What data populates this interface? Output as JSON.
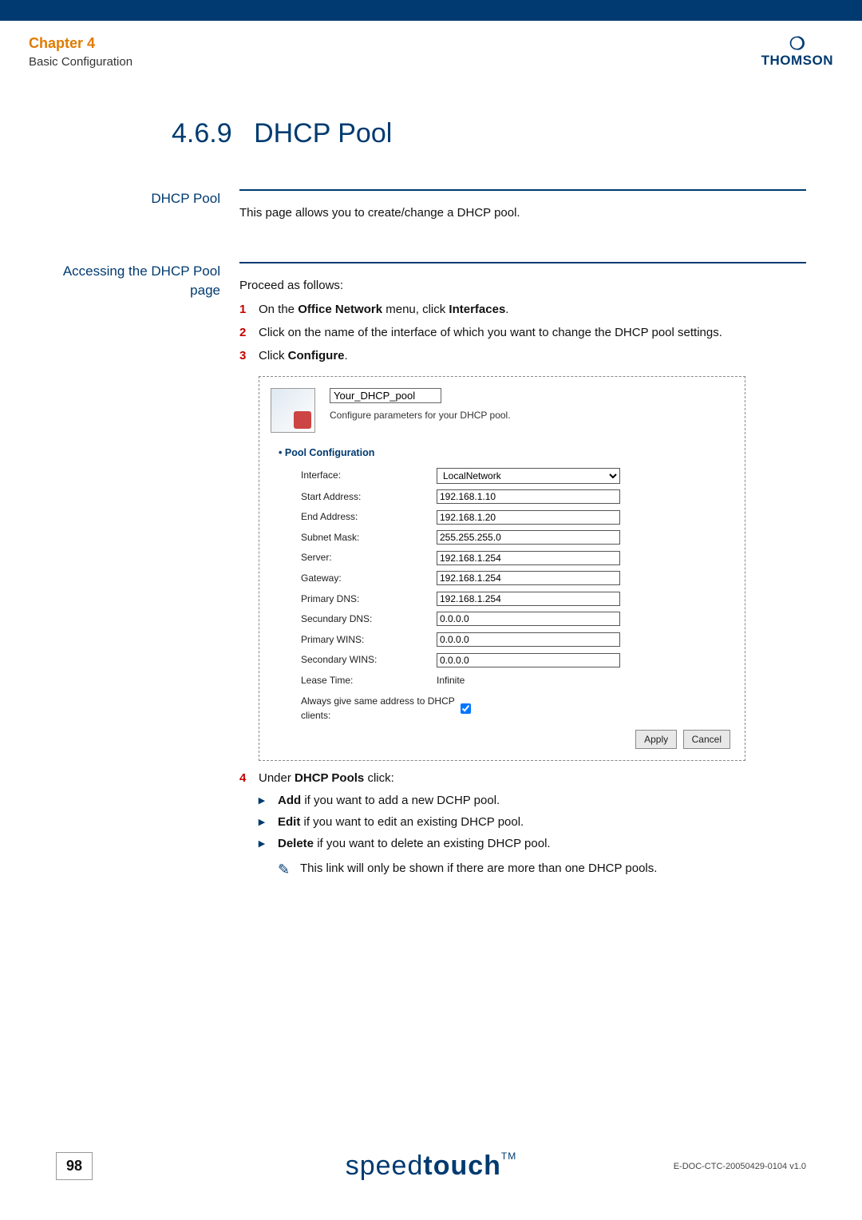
{
  "header": {
    "chapter": "Chapter 4",
    "subtitle": "Basic Configuration",
    "brand": "THOMSON"
  },
  "section": {
    "number": "4.6.9",
    "title": "DHCP Pool"
  },
  "block1": {
    "sidehead": "DHCP Pool",
    "text": "This page allows you to create/change a DHCP pool."
  },
  "block2": {
    "sidehead": "Accessing the DHCP Pool page",
    "intro": "Proceed as follows:",
    "steps": {
      "s1_pre": "On the ",
      "s1_b1": "Office Network",
      "s1_mid": " menu, click ",
      "s1_b2": "Interfaces",
      "s1_post": ".",
      "s2": "Click on the name of the interface of which you want to change the DHCP pool settings.",
      "s3_pre": "Click ",
      "s3_b": "Configure",
      "s3_post": ".",
      "s4_pre": "Under ",
      "s4_b": "DHCP Pools",
      "s4_post": " click:"
    },
    "sub": {
      "add_b": "Add",
      "add_t": " if you want to add a new DCHP pool.",
      "edit_b": "Edit",
      "edit_t": " if you want to edit an existing DHCP pool.",
      "del_b": "Delete",
      "del_t": " if you want to delete an existing DHCP pool.",
      "note": "This link will only be shown if there are more than one DHCP pools."
    }
  },
  "screenshot": {
    "poolname": "Your_DHCP_pool",
    "desc": "Configure parameters for your DHCP pool.",
    "config_title": "Pool Configuration",
    "labels": {
      "interface": "Interface:",
      "start": "Start Address:",
      "end": "End Address:",
      "subnet": "Subnet Mask:",
      "server": "Server:",
      "gateway": "Gateway:",
      "pdns": "Primary DNS:",
      "sdns": "Secundary DNS:",
      "pwins": "Primary WINS:",
      "swins": "Secondary WINS:",
      "lease": "Lease Time:",
      "always": "Always give same address to DHCP clients:"
    },
    "values": {
      "interface": "LocalNetwork",
      "start": "192.168.1.10",
      "end": "192.168.1.20",
      "subnet": "255.255.255.0",
      "server": "192.168.1.254",
      "gateway": "192.168.1.254",
      "pdns": "192.168.1.254",
      "sdns": "0.0.0.0",
      "pwins": "0.0.0.0",
      "swins": "0.0.0.0",
      "lease": "Infinite"
    },
    "buttons": {
      "apply": "Apply",
      "cancel": "Cancel"
    }
  },
  "footer": {
    "page": "98",
    "brand_light": "speed",
    "brand_bold": "touch",
    "tm": "TM",
    "docid": "E-DOC-CTC-20050429-0104 v1.0"
  }
}
